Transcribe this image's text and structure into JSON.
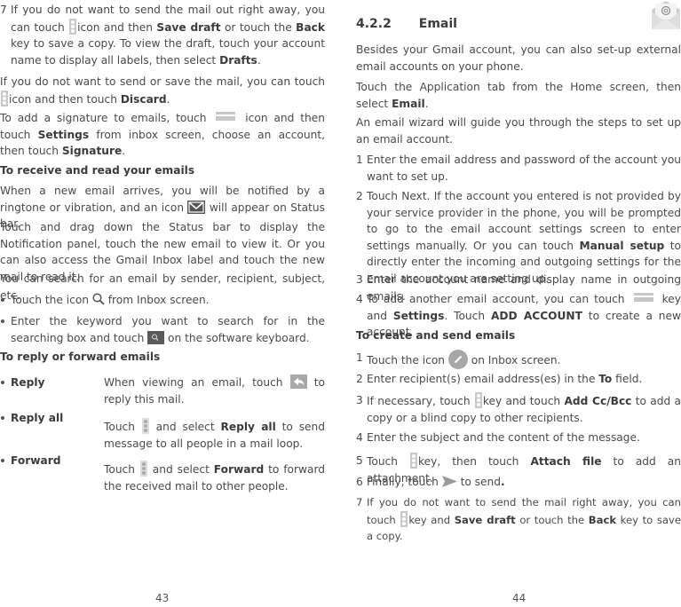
{
  "left_page": {
    "item7": {
      "num": "7",
      "t1": "If you do not want to send the mail out right away, you can touch ",
      "t2": "icon and then ",
      "b1": "Save draft",
      "t3": " or touch the ",
      "b2": "Back",
      "t4": " key to save a copy. To view the draft, touch your account name to display all labels, then select ",
      "b3": "Drafts",
      "t5": "."
    },
    "discard": {
      "t1": "If you do not want to send or save the mail, you can touch ",
      "t2": "icon and then touch ",
      "b1": "Discard",
      "t3": "."
    },
    "signature": {
      "t1": "To add a signature to emails, touch ",
      "t2": " icon and then touch ",
      "b1": "Settings",
      "t3": " from inbox screen, choose an account, then touch ",
      "b2": "Signature",
      "t4": "."
    },
    "receive_heading": "To receive and read your emails",
    "receive_p1": {
      "t1": "When a new email arrives, you will be notified by a ringtone or vibration, and an icon ",
      "t2": " will appear on Status bar."
    },
    "receive_p2": "Touch and drag down the Status bar to display the Notification panel, touch the new email to view it. Or you can also access the Gmail Inbox label and touch the new mail to read it.",
    "search_intro": "You can search for an email by sender, recipient, subject, etc.",
    "search_bullet1": {
      "t1": "Touch the icon ",
      "t2": " from Inbox screen."
    },
    "search_bullet2": {
      "t1": "Enter the keyword you want to search for in the searching box and touch ",
      "t2": " on the software keyboard."
    },
    "reply_heading": "To reply or forward emails",
    "reply_rows": [
      {
        "label": "Reply",
        "t1": "When viewing an email, touch ",
        "t2": " to reply this mail."
      },
      {
        "label": "Reply all",
        "t1": "Touch ",
        "t2": " and select ",
        "b1": "Reply all",
        "t3": " to send message to all people in a mail loop."
      },
      {
        "label": "Forward",
        "t1": "Touch ",
        "t2": " and select ",
        "b1": "Forward",
        "t3": " to forward the received mail to other people."
      }
    ],
    "page_number": "43"
  },
  "right_page": {
    "section_number": "4.2.2",
    "section_title": "Email",
    "intro1": "Besides your Gmail account, you can also set-up external email accounts on your phone.",
    "intro2": {
      "t1": "Touch the Application tab from the Home screen, then select ",
      "b1": "Email",
      "t2": "."
    },
    "intro3": "An email wizard will guide you through the steps to set up an email account.",
    "setup_steps": [
      {
        "num": "1",
        "text": "Enter the email address and password of the account you want to set up."
      },
      {
        "num": "2",
        "t1": "Touch Next. If the account you entered is not provided by your service provider in the phone, you will be prompted to go to the email account settings screen to enter settings manually. Or you can touch ",
        "b1": "Manual setup",
        "t2": " to directly enter the incoming and outgoing settings for the email account you are setting up."
      },
      {
        "num": "3",
        "text": "Enter the account name and display name in outgoing emails."
      },
      {
        "num": "4",
        "t1": "To add another email account, you can touch ",
        "t2": " key and ",
        "b1": "Settings",
        "t3": ". Touch ",
        "b2": "ADD ACCOUNT",
        "t4": " to create a new account."
      }
    ],
    "create_heading": "To create and send emails",
    "create_steps": [
      {
        "num": "1",
        "t1": "Touch the icon ",
        "t2": " on Inbox screen."
      },
      {
        "num": "2",
        "t1": "Enter recipient(s) email address(es) in the ",
        "b1": "To",
        "t2": " field."
      },
      {
        "num": "3",
        "t1": "If necessary, touch ",
        "t2": "key and touch ",
        "b1": "Add Cc/Bcc",
        "t3": " to add a copy or a blind copy to other recipients."
      },
      {
        "num": "4",
        "text": "Enter the subject and the content of the message."
      },
      {
        "num": "5",
        "t1": "Touch ",
        "t2": "key, then touch ",
        "b1": "Attach file",
        "t3": " to add an attachment."
      },
      {
        "num": "6",
        "t1": "Finally, touch ",
        "t2": " to send",
        "b1": "."
      },
      {
        "num": "7",
        "t1": "If you do not want to send the mail right away, you can touch ",
        "t2": "key and ",
        "b1": "Save draft",
        "t3": " or touch the ",
        "b2": "Back",
        "t4": " key to save a copy."
      }
    ],
    "page_number": "44"
  },
  "icons": {
    "more_dots": "vertical-more-icon",
    "menu": "hamburger-menu-icon",
    "gmail": "gmail-notification-icon",
    "search": "search-icon",
    "search_key": "search-key-icon",
    "reply": "reply-icon",
    "compose": "compose-pencil-icon",
    "send": "send-icon",
    "email_app": "email-app-icon"
  },
  "colors": {
    "text": "#4a4a4a",
    "bold": "#3c3c3c",
    "icon_gray": "#c9c9c9",
    "icon_dark": "#555555"
  }
}
